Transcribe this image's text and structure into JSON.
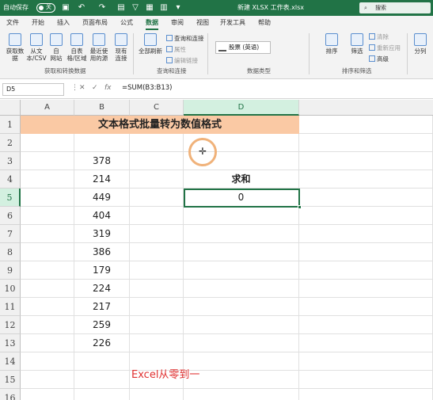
{
  "titlebar": {
    "autosave_label": "自动保存",
    "autosave_state": "关",
    "doc_title": "新建 XLSX 工作表.xlsx",
    "search_placeholder": "搜索"
  },
  "tabs": [
    "文件",
    "开始",
    "插入",
    "页面布局",
    "公式",
    "数据",
    "审阅",
    "视图",
    "开发工具",
    "帮助"
  ],
  "active_tab": "数据",
  "ribbon": {
    "get_data": "获取数\n据",
    "from_csv": "从文\n本/CSV",
    "from_web": "自\n网站",
    "from_table": "自表\n格/区域",
    "recent_sources": "最近使\n用的源",
    "existing_conn": "现有\n连接",
    "refresh_all": "全部刷新",
    "queries_conn": "查询和连接",
    "properties": "属性",
    "edit_links": "编辑链接",
    "stock": "股票 (英语)",
    "sort_az": "排序",
    "filter": "筛选",
    "clear": "清除",
    "reapply": "重新应用",
    "advanced": "高级",
    "split": "分列",
    "group_get_transform": "获取和转换数据",
    "group_queries": "查询和连接",
    "group_datatypes": "数据类型",
    "group_sortfilter": "排序和筛选"
  },
  "formula_bar": {
    "name_box": "D5",
    "formula": "=SUM(B3:B13)"
  },
  "sheet": {
    "columns": [
      "A",
      "B",
      "C",
      "D"
    ],
    "rows": [
      "1",
      "2",
      "3",
      "4",
      "5",
      "6",
      "7",
      "8",
      "9",
      "10",
      "11",
      "12",
      "13",
      "14",
      "15",
      "16"
    ],
    "title": "文本格式批量转为数值格式",
    "b_values": [
      "378",
      "214",
      "449",
      "404",
      "319",
      "386",
      "179",
      "224",
      "217",
      "259",
      "226"
    ],
    "d4_label": "求和",
    "d5_value": "0",
    "watermark": "Excel从零到一",
    "selected_cell": "D5"
  }
}
